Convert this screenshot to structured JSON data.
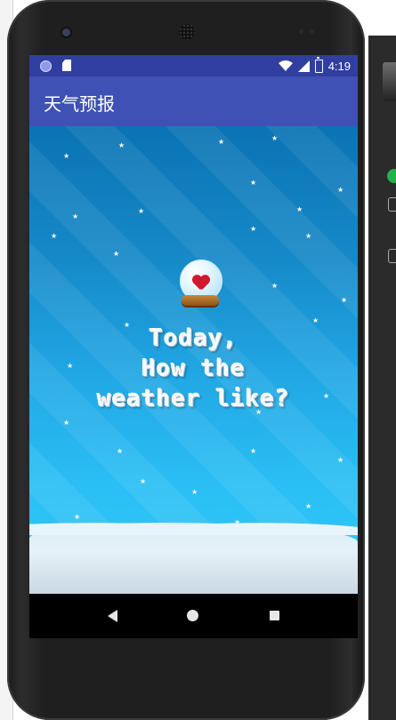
{
  "status_bar": {
    "time": "4:19",
    "icons": [
      "notification-circle-icon",
      "sd-card-icon",
      "wifi-icon",
      "signal-icon",
      "battery-charging-icon"
    ]
  },
  "app_bar": {
    "title": "天气预报"
  },
  "splash": {
    "lines": [
      "Today,",
      "How the",
      "weather like?"
    ],
    "graphic": "snow-globe-heart-icon"
  },
  "nav_bar": {
    "buttons": [
      "back-icon",
      "home-icon",
      "recents-icon"
    ]
  },
  "colors": {
    "status_bar": "#303f9f",
    "app_bar": "#3f51b5",
    "sky_top": "#0a73b3",
    "sky_bottom": "#33c8f7"
  }
}
